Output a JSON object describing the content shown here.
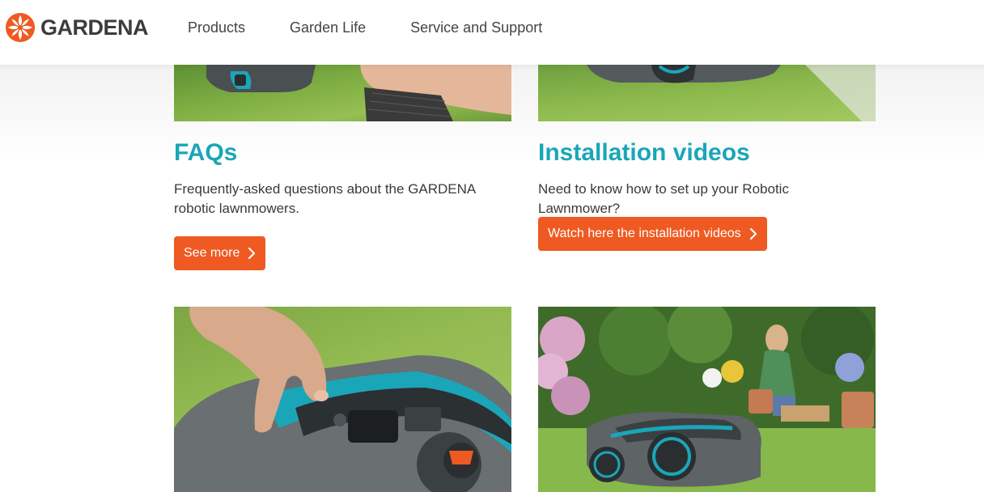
{
  "brand": {
    "name": "GARDENA",
    "accent_color": "#ef5a22",
    "title_color": "#1aa6b8"
  },
  "nav": {
    "items": [
      {
        "label": "Products"
      },
      {
        "label": "Garden Life"
      },
      {
        "label": "Service and Support"
      }
    ]
  },
  "cards": {
    "faqs": {
      "title": "FAQs",
      "text": "Frequently-asked questions about the GARDENA robotic lawnmowers.",
      "button_label": "See more",
      "button_icon": "chevron-right-icon"
    },
    "videos": {
      "title": "Installation videos",
      "text": "Need to know how to set up your Robotic Lawnmower?",
      "button_label": "Watch here the installation videos",
      "button_icon": "chevron-right-icon"
    }
  },
  "images": {
    "top_left": "robotic-mower-hand-photo",
    "top_right": "robotic-mower-lawn-photo",
    "bottom_left": "mower-control-panel-photo",
    "bottom_right": "garden-mower-woman-photo"
  }
}
